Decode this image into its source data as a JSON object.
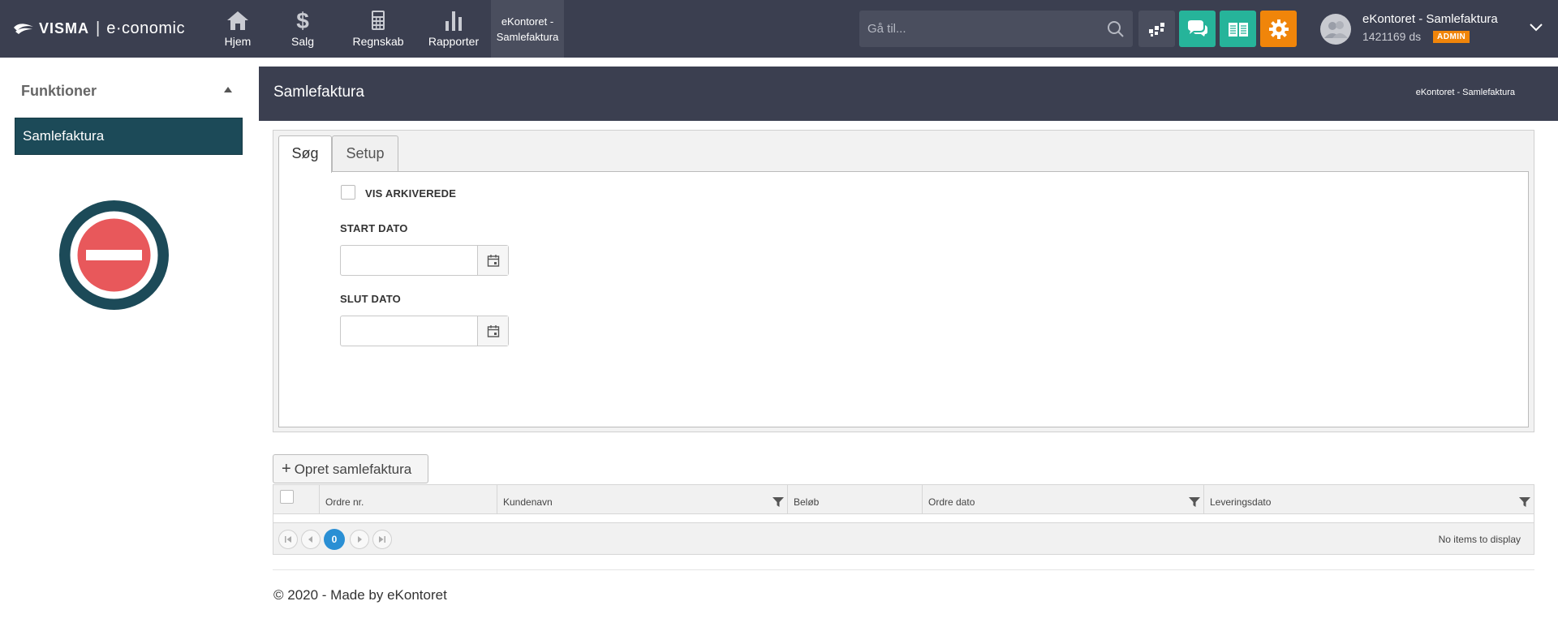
{
  "brand": {
    "visma": "VISMA",
    "separator": "|",
    "product": "e·conomic"
  },
  "nav": [
    {
      "label": "Hjem",
      "icon": "home-icon"
    },
    {
      "label": "Salg",
      "icon": "dollar-icon"
    },
    {
      "label": "Regnskab",
      "icon": "calculator-icon"
    },
    {
      "label": "Rapporter",
      "icon": "bar-chart-icon"
    },
    {
      "label_line1": "eKontoret -",
      "label_line2": "Samlefaktura",
      "active": true
    }
  ],
  "search": {
    "placeholder": "Gå til..."
  },
  "toolbar_colors": {
    "apps": "#4a4e5e",
    "chat": "#26b49a",
    "docs": "#26b49a",
    "settings": "#f0850a"
  },
  "user": {
    "name": "eKontoret - Samlefaktura",
    "code": "1421169 ds",
    "badge": "ADMIN"
  },
  "sidebar": {
    "heading": "Funktioner",
    "items": [
      {
        "label": "Samlefaktura",
        "active": true
      }
    ]
  },
  "page": {
    "title": "Samlefaktura",
    "breadcrumb": "eKontoret - Samlefaktura"
  },
  "tabs": [
    {
      "label": "Søg",
      "active": true
    },
    {
      "label": "Setup",
      "active": false
    }
  ],
  "form": {
    "archived_label": "VIS ARKIVEREDE",
    "archived_checked": false,
    "start_label": "START DATO",
    "start_value": "",
    "end_label": "SLUT DATO",
    "end_value": ""
  },
  "create_button": "Opret samlefaktura",
  "grid": {
    "columns": [
      {
        "label": "Ordre nr.",
        "filter": false
      },
      {
        "label": "Kundenavn",
        "filter": true
      },
      {
        "label": "Beløb",
        "filter": false
      },
      {
        "label": "Ordre dato",
        "filter": true
      },
      {
        "label": "Leveringsdato",
        "filter": true
      }
    ],
    "rows": []
  },
  "pager": {
    "current_page": "0",
    "info": "No items to display"
  },
  "footer": "© 2020 - Made by eKontoret",
  "colors": {
    "topbar": "#3b3f50",
    "sidebar_active": "#1c4a58",
    "accent": "#2a8fd4",
    "logo_ring": "#1c4a58",
    "logo_center": "#e8585b"
  }
}
